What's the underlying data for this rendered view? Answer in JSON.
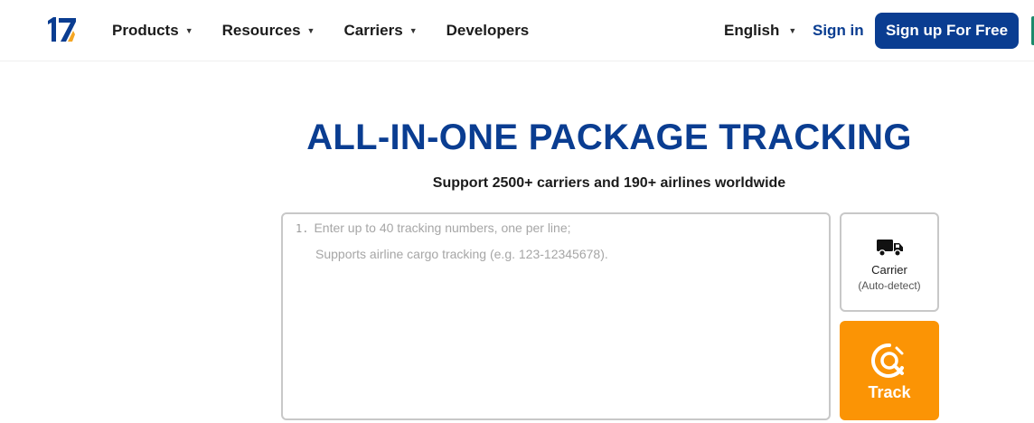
{
  "header": {
    "logo_text": "17",
    "nav": [
      {
        "label": "Products",
        "has_caret": true
      },
      {
        "label": "Resources",
        "has_caret": true
      },
      {
        "label": "Carriers",
        "has_caret": true
      },
      {
        "label": "Developers",
        "has_caret": false
      }
    ],
    "language": "English",
    "signin_label": "Sign in",
    "signup_label": "Sign up For Free"
  },
  "hero": {
    "title": "ALL-IN-ONE PACKAGE TRACKING",
    "subtitle": "Support 2500+ carriers and 190+ airlines worldwide"
  },
  "tracking_input": {
    "line_number": "1.",
    "placeholder_line1": "Enter up to 40 tracking numbers, one per line;",
    "placeholder_line2": "Supports airline cargo tracking (e.g. 123-12345678)."
  },
  "carrier_selector": {
    "label": "Carrier",
    "sub_label": "(Auto-detect)",
    "icon": "truck-icon"
  },
  "track_button": {
    "label": "Track",
    "icon": "search-package-icon"
  },
  "colors": {
    "brand_blue": "#0a3d91",
    "track_orange": "#fb9405",
    "logo_accent": "#f5a623"
  }
}
